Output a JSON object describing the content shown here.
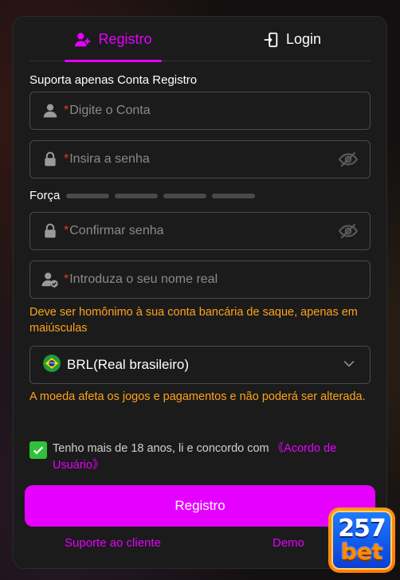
{
  "tabs": {
    "register": "Registro",
    "login": "Login"
  },
  "form": {
    "support_note": "Suporta apenas Conta Registro",
    "required_mark": "*",
    "account_placeholder": "Digite o Conta",
    "password_placeholder": "Insira a senha",
    "strength_label": "Força",
    "confirm_placeholder": "Confirmar senha",
    "realname_placeholder": "Introduza o seu nome real",
    "realname_hint": "Deve ser homônimo à sua conta bancária de saque, apenas em maiúsculas",
    "currency_value": "BRL(Real brasileiro)",
    "currency_hint": "A moeda afeta os jogos e pagamentos e não poderá ser alterada.",
    "agree_text": "Tenho mais de 18 anos, li e concordo com ",
    "agree_link": "《Acordo de Usuário》",
    "submit_label": "Registro"
  },
  "footer": {
    "support": "Suporte ao cliente",
    "demo": "Demo"
  },
  "logo": {
    "line1": "257",
    "line2": "bet"
  },
  "colors": {
    "accent": "#e600ff",
    "warning": "#ffa31a",
    "check": "#2fc13a"
  },
  "icons": [
    "user-plus-icon",
    "login-icon",
    "user-icon",
    "lock-icon",
    "eye-off-icon",
    "user-check-icon",
    "brazil-flag-icon",
    "chevron-down-icon",
    "check-icon"
  ]
}
